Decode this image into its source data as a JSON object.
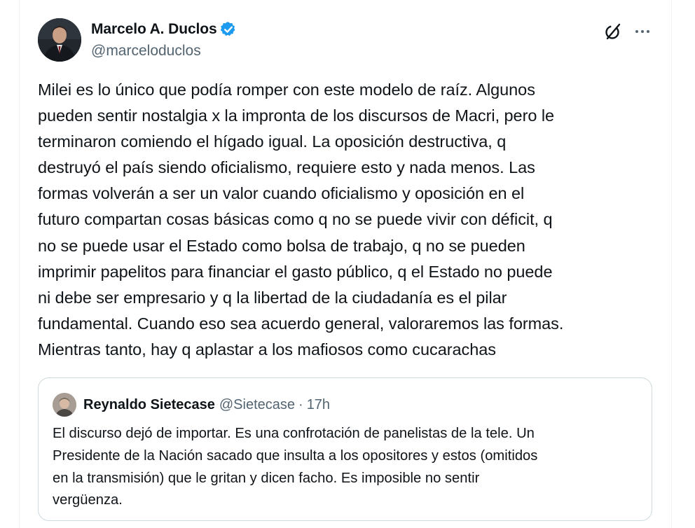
{
  "tweet": {
    "author": {
      "display_name": "Marcelo A. Duclos",
      "handle": "@marceloduclos",
      "verified": true,
      "avatar_icon": "profile-photo"
    },
    "actions": {
      "grok_icon": "grok-icon",
      "more_icon": "more-icon"
    },
    "text": "Milei es lo único que podía romper con este modelo de raíz. Algunos\npueden sentir nostalgia x la impronta de los discursos de Macri, pero le\nterminaron comiendo el hígado igual. La oposición destructiva, q\ndestruyó el país siendo oficialismo, requiere esto y nada menos. Las\nformas volverán a ser un valor cuando oficialismo y oposición en el\nfuturo compartan cosas básicas como q no se puede vivir con déficit, q\nno se puede usar el Estado como bolsa de trabajo, q no se pueden\nimprimir papelitos para financiar el gasto público, q el Estado no puede\nni debe ser empresario y q la libertad de la ciudadanía es el pilar\nfundamental. Cuando eso sea acuerdo general, valoraremos las formas.\nMientras tanto, hay q aplastar a los mafiosos como cucarachas"
  },
  "quoted_tweet": {
    "display_name": "Reynaldo Sietecase",
    "handle": "@Sietecase",
    "separator": "·",
    "time": "17h",
    "text": "El discurso dejó de importar. Es una confrotación de panelistas de la tele. Un\nPresidente de la Nación sacado que insulta a los opositores y estos (omitidos\nen la transmisión) que le gritan y dicen facho. Es imposible no sentir\nvergüenza."
  },
  "colors": {
    "text_primary": "#0f1419",
    "text_secondary": "#536471",
    "verified_blue": "#1d9bf0",
    "border": "#cfd9de"
  }
}
